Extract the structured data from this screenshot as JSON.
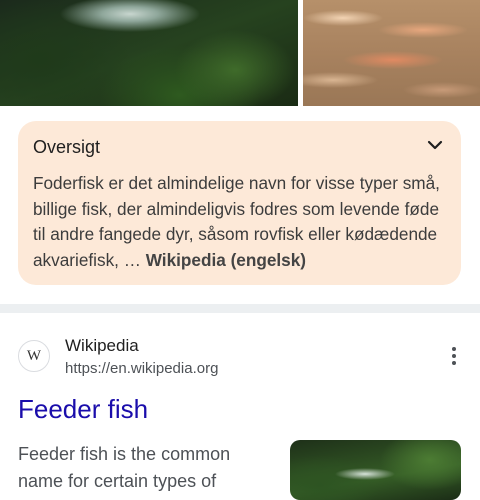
{
  "images": {
    "left": "fish-photo",
    "right": "feeder-fish-group-photo"
  },
  "overview": {
    "title": "Oversigt",
    "text": "Foderfisk er det almindelige navn for visse typer små, billige fisk, der almindeligvis fodres som levende føde til andre fangede dyr, såsom rovfisk eller kødædende akvariefisk,",
    "ellipsis": " … ",
    "source_link": "Wikipedia (engelsk)",
    "bg_color": "#fde9d8"
  },
  "result": {
    "favicon_letter": "W",
    "site_name": "Wikipedia",
    "site_url": "https://en.wikipedia.org",
    "title": "Feeder fish",
    "title_color": "#1a0dab",
    "snippet": "Feeder fish is the common name for certain types of"
  }
}
